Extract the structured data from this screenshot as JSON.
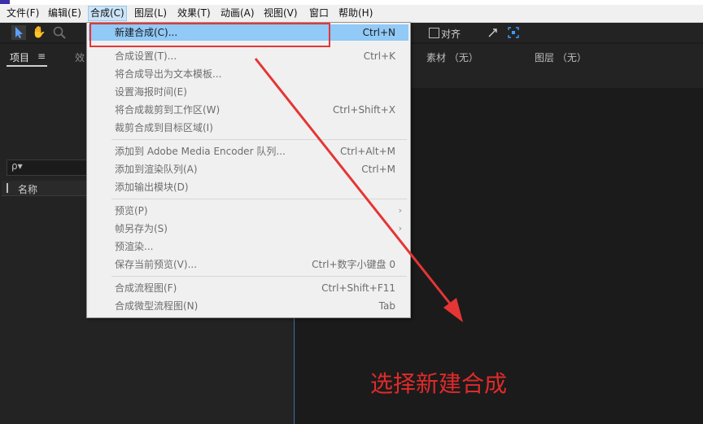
{
  "menubar": {
    "items": [
      "文件(F)",
      "编辑(E)",
      "合成(C)",
      "图层(L)",
      "效果(T)",
      "动画(A)",
      "视图(V)",
      "窗口",
      "帮助(H)"
    ],
    "active_index": 2
  },
  "toolbar": {
    "snap_label": "对齐"
  },
  "left_panel": {
    "tab_project": "项目",
    "tab_menu_icon": "≡",
    "tab_effects": "效",
    "search_icon": "ρ▾",
    "column_name": "名称"
  },
  "right_panel": {
    "footage_label": "素材 （无）",
    "layer_label": "图层 （无）"
  },
  "dropdown": {
    "groups": [
      [
        {
          "label": "新建合成(C)...",
          "shortcut": "Ctrl+N",
          "enabled": true,
          "highlighted": true
        },
        {
          "label": "合成设置(T)...",
          "shortcut": "Ctrl+K",
          "enabled": false
        },
        {
          "label": "将合成导出为文本模板...",
          "shortcut": "",
          "enabled": false
        },
        {
          "label": "设置海报时间(E)",
          "shortcut": "",
          "enabled": false
        },
        {
          "label": "将合成裁剪到工作区(W)",
          "shortcut": "Ctrl+Shift+X",
          "enabled": false
        },
        {
          "label": "裁剪合成到目标区域(I)",
          "shortcut": "",
          "enabled": false
        }
      ],
      [
        {
          "label": "添加到 Adobe Media Encoder 队列...",
          "shortcut": "Ctrl+Alt+M",
          "enabled": false
        },
        {
          "label": "添加到渲染队列(A)",
          "shortcut": "Ctrl+M",
          "enabled": false
        },
        {
          "label": "添加输出模块(D)",
          "shortcut": "",
          "enabled": false
        }
      ],
      [
        {
          "label": "预览(P)",
          "shortcut": "",
          "enabled": false,
          "submenu": true
        },
        {
          "label": "帧另存为(S)",
          "shortcut": "",
          "enabled": false,
          "submenu": true
        },
        {
          "label": "预渲染...",
          "shortcut": "",
          "enabled": false
        },
        {
          "label": "保存当前预览(V)...",
          "shortcut": "Ctrl+数字小键盘 0",
          "enabled": false
        }
      ],
      [
        {
          "label": "合成流程图(F)",
          "shortcut": "Ctrl+Shift+F11",
          "enabled": false
        },
        {
          "label": "合成微型流程图(N)",
          "shortcut": "Tab",
          "enabled": false
        }
      ]
    ]
  },
  "annotation": {
    "text": "选择新建合成",
    "color": "#e02a2a"
  },
  "colors": {
    "menu_bg": "#f0f0f0",
    "highlight": "#91c9f7",
    "app_bg": "#1d1d1d",
    "accent_red": "#e53535"
  }
}
